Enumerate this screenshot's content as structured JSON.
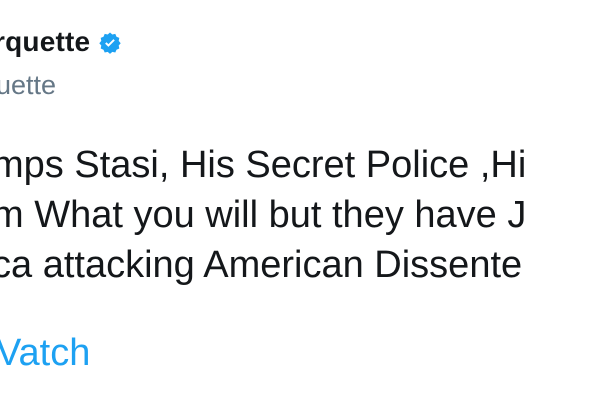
{
  "tweet": {
    "display_name": "rquette",
    "handle": "uette",
    "verified_icon": "verified-badge-icon",
    "body_lines": [
      "mps Stasi, His Secret Police ,Hi",
      "m What you will but they have J",
      "ca attacking American Dissente"
    ],
    "link_text": "Vatch"
  },
  "colors": {
    "text": "#14171a",
    "secondary": "#657786",
    "accent": "#1da1f2"
  }
}
